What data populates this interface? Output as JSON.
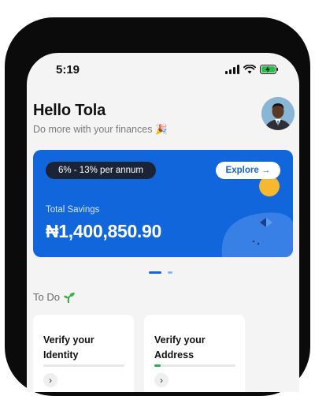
{
  "status_bar": {
    "time": "5:19"
  },
  "header": {
    "greeting": "Hello Tola",
    "subtitle": "Do more with your finances",
    "subtitle_emoji": "🎉"
  },
  "savings_card": {
    "rate": "6% - 13% per annum",
    "explore_label": "Explore →",
    "total_label": "Total Savings",
    "amount": "₦1,400,850.90",
    "color": "#1266dc"
  },
  "carousel": {
    "active_index": 0,
    "count": 2
  },
  "todo": {
    "title": "To Do",
    "items": [
      {
        "line1": "Verify your",
        "line2": "Identity",
        "progress": 0.0
      },
      {
        "line1": "Verify your",
        "line2": "Address",
        "progress": 0.08
      }
    ]
  }
}
